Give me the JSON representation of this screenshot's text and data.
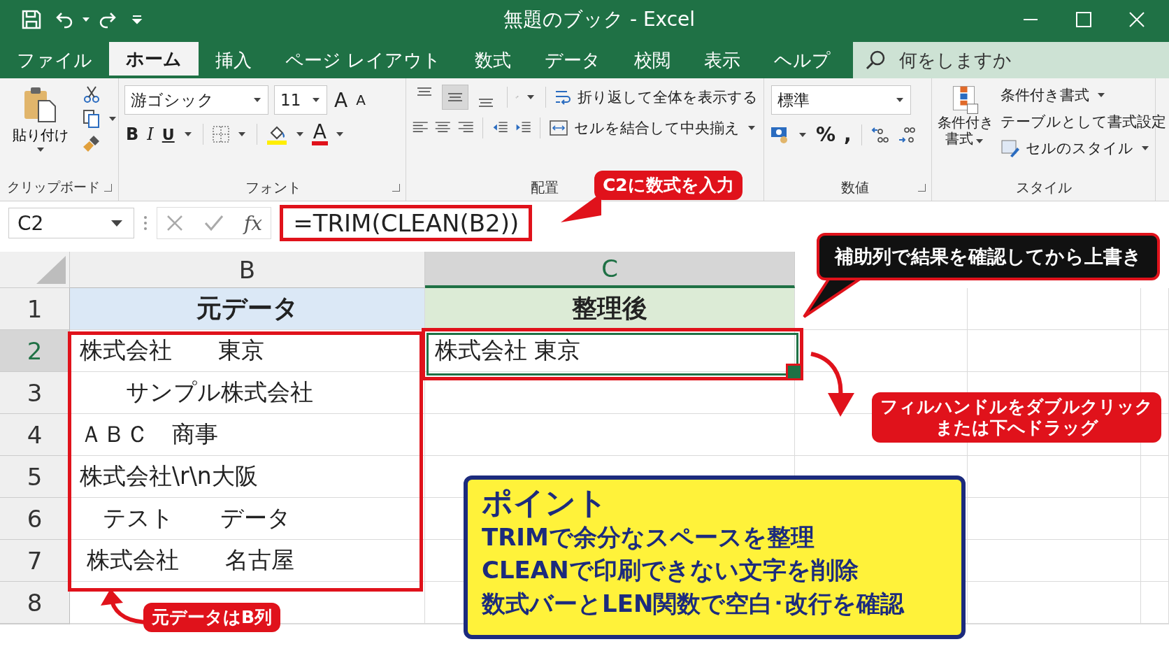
{
  "window": {
    "title": "無題のブック  -  Excel"
  },
  "tabs": [
    {
      "label": "ファイル",
      "selected": false
    },
    {
      "label": "ホーム",
      "selected": true
    },
    {
      "label": "挿入",
      "selected": false
    },
    {
      "label": "ページ レイアウト",
      "selected": false
    },
    {
      "label": "数式",
      "selected": false
    },
    {
      "label": "データ",
      "selected": false
    },
    {
      "label": "校閲",
      "selected": false
    },
    {
      "label": "表示",
      "selected": false
    },
    {
      "label": "ヘルプ",
      "selected": false
    }
  ],
  "search": {
    "placeholder": "何をしますか"
  },
  "ribbon": {
    "clipboard": {
      "paste": "貼り付け",
      "label": "クリップボード"
    },
    "font": {
      "name": "游ゴシック",
      "size": "11",
      "grow": "A",
      "shrink": "A",
      "bold": "B",
      "italic": "I",
      "underline": "U",
      "color_glyph": "A",
      "label": "フォント"
    },
    "alignment": {
      "vertical_align": [
        {
          "selected": false
        },
        {
          "selected": true
        },
        {
          "selected": false
        }
      ],
      "wrap": "折り返して全体を表示する",
      "merge": "セルを結合して中央揃え",
      "label": "配置"
    },
    "number": {
      "format": "標準",
      "percent": "%",
      "comma": ",",
      "label": "数値"
    },
    "styles": {
      "conditional_big": [
        "条件付き",
        "書式"
      ],
      "conditional": "条件付き書式",
      "table": "テーブルとして書式設定",
      "cell_styles": "セルのスタイル",
      "label": "スタイル"
    }
  },
  "formula_bar": {
    "name_box": "C2",
    "fx": "fx",
    "formula": "=TRIM(CLEAN(B2))"
  },
  "sheet": {
    "columns": [
      {
        "label": "B",
        "selected": false
      },
      {
        "label": "C",
        "selected": true
      }
    ],
    "rows": [
      {
        "number": "1",
        "selected": false,
        "cells": [
          {
            "kind": "header",
            "text": "元データ",
            "color": "#dbe8f6"
          },
          {
            "kind": "header",
            "text": "整理後",
            "color": "#dcebd6"
          }
        ]
      },
      {
        "number": "2",
        "selected": true,
        "cells": [
          {
            "kind": "value",
            "text": "株式会社　　東京"
          },
          {
            "kind": "value",
            "text": "株式会社 東京"
          }
        ]
      },
      {
        "number": "3",
        "selected": false,
        "cells": [
          {
            "kind": "value",
            "text": "　　サンプル株式会社"
          }
        ]
      },
      {
        "number": "4",
        "selected": false,
        "cells": [
          {
            "kind": "value",
            "text": "ＡＢＣ　商事"
          }
        ]
      },
      {
        "number": "5",
        "selected": false,
        "cells": [
          {
            "kind": "value",
            "text": "株式会社\\r\\n大阪"
          }
        ]
      },
      {
        "number": "6",
        "selected": false,
        "cells": [
          {
            "kind": "value",
            "text": "　テスト　　データ"
          }
        ]
      },
      {
        "number": "7",
        "selected": false,
        "cells": [
          {
            "kind": "value",
            "text": " 株式会社　　名古屋"
          }
        ]
      },
      {
        "number": "8",
        "selected": false
      }
    ]
  },
  "callouts": [
    {
      "kind": "alert",
      "lines": [
        "C2に数式を入力"
      ]
    },
    {
      "kind": "note",
      "lines": [
        "補助列で結果を確認してから上書き"
      ]
    },
    {
      "kind": "alert",
      "lines": [
        "フィルハンドルをダブルクリック",
        "または下へドラッグ"
      ]
    },
    {
      "kind": "alert",
      "lines": [
        "元データはB列"
      ]
    }
  ],
  "point": {
    "title": "ポイント",
    "lines": [
      "TRIMで余分なスペースを整理",
      "CLEANで印刷できない文字を削除",
      "数式バーとLEN関数で空白･改行を確認"
    ]
  }
}
